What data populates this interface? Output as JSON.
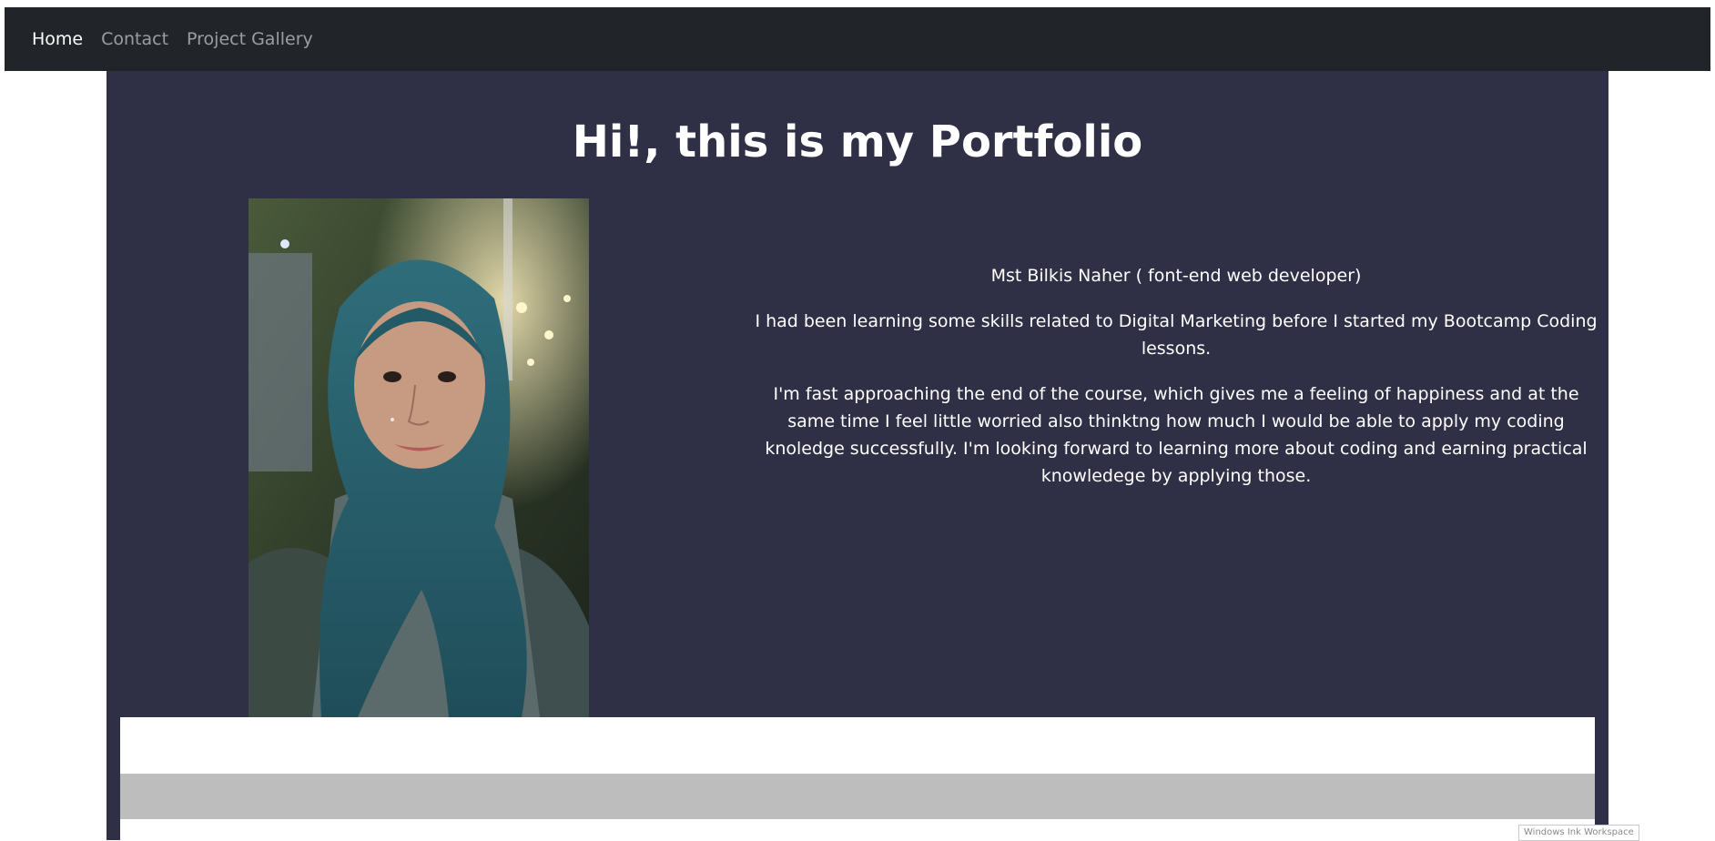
{
  "nav": {
    "items": [
      {
        "label": "Home",
        "active": true
      },
      {
        "label": "Contact",
        "active": false
      },
      {
        "label": "Project Gallery",
        "active": false
      }
    ]
  },
  "hero": {
    "title": "Hi!, this is my Portfolio",
    "name_line": "Mst Bilkis Naher ( font-end web developer)",
    "paragraph_1": "I had been learning some skills related to Digital Marketing before I started my Bootcamp Coding lessons.",
    "paragraph_2": "I'm fast approaching the end of the course, which gives me a feeling of happiness and at the same time I feel little worried also thinktng how much I would be able to apply my coding knoledge successfully. I'm looking forward to learning more about coding and earning practical knowledege by applying those."
  },
  "system": {
    "ink_workspace_label": "Windows Ink Workspace"
  },
  "colors": {
    "navbar_bg": "#212529",
    "main_bg": "#2f2f46",
    "gray_band": "#bdbdbd"
  }
}
